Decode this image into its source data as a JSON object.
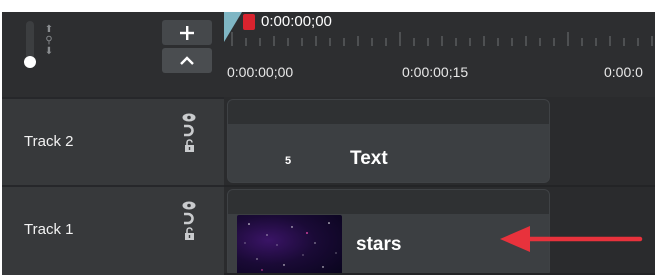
{
  "controls": {
    "add_label": "+",
    "collapse_label": "^"
  },
  "ruler": {
    "playhead_time": "0:00:00;00",
    "labels": [
      "0:00:00;00",
      "0:00:00;15",
      "0:00:0"
    ]
  },
  "tracks": [
    {
      "name": "Track 2",
      "clip": {
        "label": "Text",
        "badge": "5",
        "type": "text"
      }
    },
    {
      "name": "Track 1",
      "clip": {
        "label": "stars",
        "type": "media"
      }
    }
  ],
  "colors": {
    "accent_arrow": "#e8323c",
    "playhead": "#d9232e",
    "playhead_marker": "#7fb6c4",
    "background": "#2d2e30"
  },
  "icons": [
    "zoom-in-icon",
    "zoom-out-icon",
    "visibility-eye-icon",
    "magnet-icon",
    "lock-icon",
    "plus-icon",
    "chevron-up-icon"
  ]
}
